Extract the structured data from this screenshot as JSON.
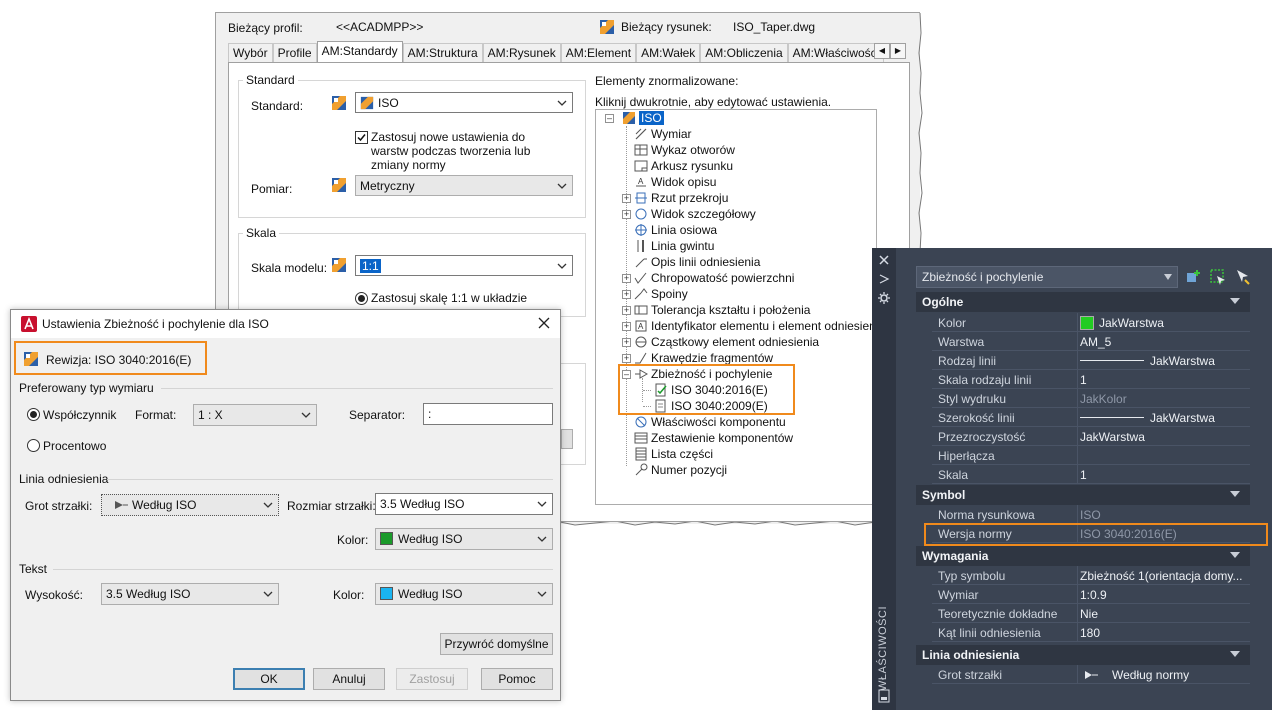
{
  "options": {
    "current_profile_label": "Bieżący profil:",
    "current_profile_value": "<<ACADMPP>>",
    "current_drawing_label": "Bieżący rysunek:",
    "current_drawing_value": "ISO_Taper.dwg",
    "tabs": [
      "Wybór",
      "Profile",
      "AM:Standardy",
      "AM:Struktura",
      "AM:Rysunek",
      "AM:Element",
      "AM:Wałek",
      "AM:Obliczenia",
      "AM:Właściwości"
    ],
    "standard_group": "Standard",
    "standard_label": "Standard:",
    "standard_value": "ISO",
    "apply_check_text": [
      "Zastosuj nowe ustawienia do",
      "warstw podczas tworzenia lub",
      "zmiany normy"
    ],
    "measure_label": "Pomiar:",
    "measure_value": "Metryczny",
    "scale_group": "Skala",
    "model_scale_label": "Skala modelu:",
    "model_scale_value": "1:1",
    "apply_scale_text": "Zastosuj skalę 1:1 w układzie",
    "std_elements_label": "Elementy znormalizowane:",
    "std_elements_hint": "Kliknij dwukrotnie, aby edytować ustawienia.",
    "tree": {
      "root": "ISO",
      "items": [
        "Wymiar",
        "Wykaz otworów",
        "Arkusz rysunku",
        "Widok opisu",
        "Rzut przekroju",
        "Widok szczegółowy",
        "Linia osiowa",
        "Linia gwintu",
        "Opis linii odniesienia",
        "Chropowatość powierzchni",
        "Spoiny",
        "Tolerancja kształtu i położenia",
        "Identyfikator elementu i element odniesienia",
        "Cząstkowy element odniesienia",
        "Krawędzie fragmentów",
        "Zbieżność i pochylenie",
        "ISO 3040:2016(E)",
        "ISO 3040:2009(E)",
        "Właściwości komponentu",
        "Zestawienie komponentów",
        "Lista części",
        "Numer pozycji"
      ]
    }
  },
  "dialog": {
    "title": "Ustawienia Zbieżność i pochylenie dla ISO",
    "revision": "Rewizja: ISO 3040:2016(E)",
    "pref_section": "Preferowany typ wymiaru",
    "coef_label": "Współczynnik",
    "percent_label": "Procentowo",
    "format_label": "Format:",
    "format_value": "1 : X",
    "separator_label": "Separator:",
    "separator_value": ":",
    "leader_section": "Linia odniesienia",
    "arrowhead_label": "Grot strzałki:",
    "arrowhead_value": "Według ISO",
    "arrow_size_label": "Rozmiar strzałki:",
    "arrow_size_value": "3.5  Według ISO",
    "leader_color_label": "Kolor:",
    "leader_color_value": "Według ISO",
    "leader_color_hex": "#1a9a2a",
    "text_section": "Tekst",
    "height_label": "Wysokość:",
    "height_value": "3.5  Według ISO",
    "text_color_label": "Kolor:",
    "text_color_value": "Według ISO",
    "text_color_hex": "#1ab4f0",
    "restore_btn": "Przywróć domyślne",
    "ok_btn": "OK",
    "cancel_btn": "Anuluj",
    "apply_btn": "Zastosuj",
    "help_btn": "Pomoc"
  },
  "props": {
    "dropdown": "Zbieżność i pochylenie",
    "side_title": "WŁAŚCIWOŚCI",
    "categories": {
      "general": "Ogólne",
      "symbol": "Symbol",
      "requirements": "Wymagania",
      "leader": "Linia odniesienia"
    },
    "general": [
      {
        "name": "Kolor",
        "value": "JakWarstwa"
      },
      {
        "name": "Warstwa",
        "value": "AM_5"
      },
      {
        "name": "Rodzaj linii",
        "value": "JakWarstwa"
      },
      {
        "name": "Skala rodzaju linii",
        "value": "1"
      },
      {
        "name": "Styl wydruku",
        "value": "JakKolor"
      },
      {
        "name": "Szerokość linii",
        "value": "JakWarstwa"
      },
      {
        "name": "Przezroczystość",
        "value": "JakWarstwa"
      },
      {
        "name": "Hiperłącza",
        "value": ""
      },
      {
        "name": "Skala",
        "value": "1"
      }
    ],
    "symbol": [
      {
        "name": "Norma rysunkowa",
        "value": "ISO"
      },
      {
        "name": "Wersja normy",
        "value": "ISO 3040:2016(E)"
      }
    ],
    "requirements": [
      {
        "name": "Typ symbolu",
        "value": "Zbieżność 1(orientacja domy..."
      },
      {
        "name": "Wymiar",
        "value": "1:0.9"
      },
      {
        "name": "Teoretycznie dokładne",
        "value": "Nie"
      },
      {
        "name": "Kąt linii odniesienia",
        "value": "180"
      }
    ],
    "leader": [
      {
        "name": "Grot strzałki",
        "value": "Według normy"
      }
    ],
    "color_swatch_hex": "#22cc22",
    "highlight_hex": "#f08a1c"
  }
}
